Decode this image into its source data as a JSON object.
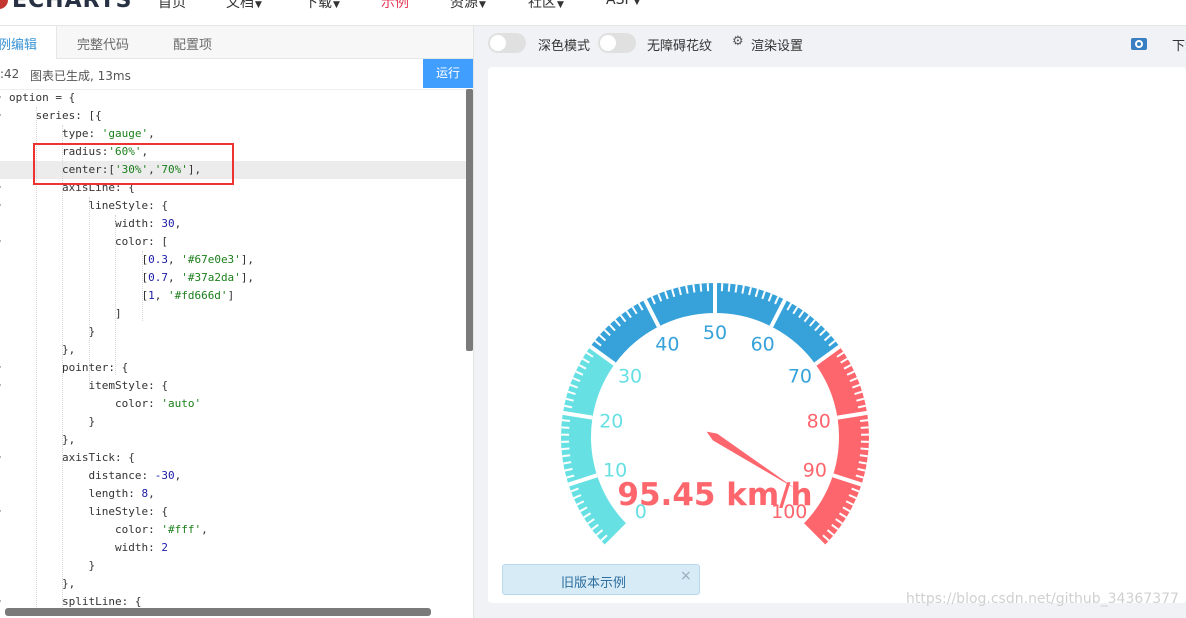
{
  "nav": {
    "logo": "ECHARTS",
    "items": [
      {
        "label": "首页",
        "caret": false,
        "active": false
      },
      {
        "label": "文档",
        "caret": true,
        "active": false
      },
      {
        "label": "下载",
        "caret": true,
        "active": false
      },
      {
        "label": "示例",
        "caret": false,
        "active": true
      },
      {
        "label": "资源",
        "caret": true,
        "active": false
      },
      {
        "label": "社区",
        "caret": true,
        "active": false
      },
      {
        "label": "ASF",
        "caret": true,
        "active": false
      }
    ]
  },
  "editor": {
    "tabs": [
      "例编辑",
      "完整代码",
      "配置项"
    ],
    "status_time": ":42",
    "status_msg": "图表已生成, 13ms",
    "run_label": "运行",
    "lines": [
      "option = {",
      "    series: [{",
      "        type: 'gauge',",
      "        radius:'60%',",
      "        center:['30%','70%'],",
      "        axisLine: {",
      "            lineStyle: {",
      "                width: 30,",
      "                color: [",
      "                    [0.3, '#67e0e3'],",
      "                    [0.7, '#37a2da'],",
      "                    [1, '#fd666d']",
      "                ]",
      "            }",
      "        },",
      "        pointer: {",
      "            itemStyle: {",
      "                color: 'auto'",
      "            }",
      "        },",
      "        axisTick: {",
      "            distance: -30,",
      "            length: 8,",
      "            lineStyle: {",
      "                color: '#fff',",
      "                width: 2",
      "            }",
      "        },",
      "        splitLine: {"
    ]
  },
  "toolbar": {
    "dark_mode": "深色模式",
    "aria_pattern": "无障碍花纹",
    "render_settings": "渲染设置",
    "download": "下载"
  },
  "chart_data": {
    "type": "gauge",
    "min": 0,
    "max": 100,
    "value": 95.45,
    "detail": "95.45 km/h",
    "ticks": [
      "0",
      "10",
      "20",
      "30",
      "40",
      "50",
      "60",
      "70",
      "80",
      "90",
      "100"
    ],
    "color_stops": [
      {
        "stop": 0.3,
        "color": "#67e0e3"
      },
      {
        "stop": 0.7,
        "color": "#37a2da"
      },
      {
        "stop": 1,
        "color": "#fd666d"
      }
    ]
  },
  "old_example": {
    "label": "旧版本示例",
    "close": "×"
  },
  "watermark": "https://blog.csdn.net/github_34367377"
}
